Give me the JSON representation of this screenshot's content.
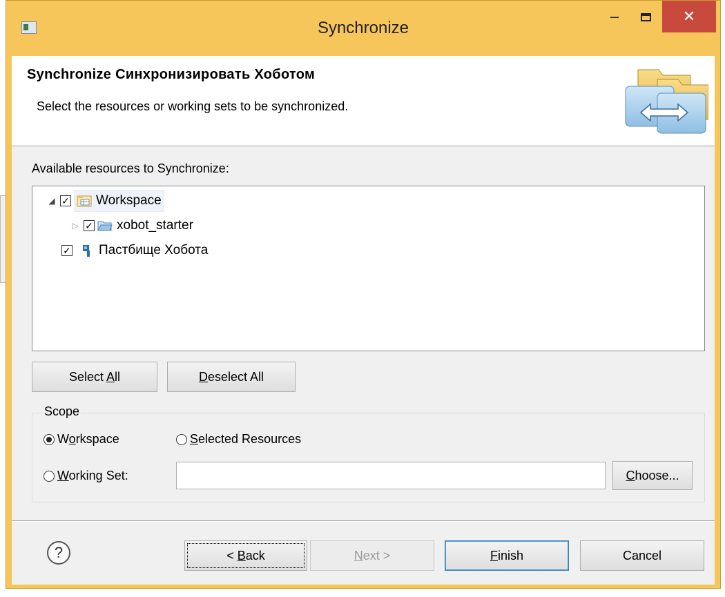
{
  "window": {
    "title": "Synchronize",
    "minimize_glyph": "–",
    "close_glyph": "✕"
  },
  "header": {
    "title": "Synchronize Синхронизировать Хоботом",
    "description": "Select the resources or working sets to be synchronized."
  },
  "resources": {
    "label": "Available resources to Synchronize:",
    "items": [
      {
        "label": "Workspace",
        "checked": true,
        "expanded": true,
        "icon": "workspace-icon"
      },
      {
        "label": "xobot_starter",
        "checked": true,
        "expanded": false,
        "icon": "folder-icon"
      },
      {
        "label": "Пастбище Хобота",
        "checked": true,
        "icon": "repository-icon"
      }
    ]
  },
  "buttons": {
    "select_all_pre": "Select ",
    "select_all_mn": "A",
    "select_all_post": "ll",
    "deselect_all_mn": "D",
    "deselect_all_post": "eselect All"
  },
  "scope": {
    "legend": "Scope",
    "workspace_pre": "W",
    "workspace_mn": "o",
    "workspace_post": "rkspace",
    "selected_mn": "S",
    "selected_post": "elected Resources",
    "working_set_mn": "W",
    "working_set_post": "orking Set:",
    "working_set_value": "",
    "choose_mn": "C",
    "choose_post": "hoose...",
    "selected_option": "Workspace"
  },
  "footer": {
    "help_glyph": "?",
    "back_pre": "< ",
    "back_mn": "B",
    "back_post": "ack",
    "next_mn": "N",
    "next_post": "ext >",
    "finish_mn": "F",
    "finish_post": "inish",
    "cancel": "Cancel"
  },
  "colors": {
    "frame": "#f6c65a",
    "close_button": "#c84a3c",
    "default_button_border": "#3c7fb1"
  }
}
